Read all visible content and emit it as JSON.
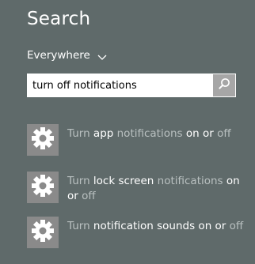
{
  "header": {
    "title": "Search"
  },
  "scope": {
    "label": "Everywhere"
  },
  "search": {
    "value": "turn off notifications",
    "button_icon": "search-icon"
  },
  "results": [
    {
      "icon": "gear-icon",
      "segments": [
        {
          "text": "Turn ",
          "dim": true
        },
        {
          "text": "app ",
          "dim": false
        },
        {
          "text": "notifications ",
          "dim": true
        },
        {
          "text": "on or ",
          "dim": false
        },
        {
          "text": "off",
          "dim": true
        }
      ]
    },
    {
      "icon": "gear-icon",
      "segments": [
        {
          "text": "Turn ",
          "dim": true
        },
        {
          "text": "lock screen ",
          "dim": false
        },
        {
          "text": "notifications ",
          "dim": true
        },
        {
          "text": "on or ",
          "dim": false
        },
        {
          "text": "off",
          "dim": true
        }
      ]
    },
    {
      "icon": "gear-icon",
      "segments": [
        {
          "text": "Turn ",
          "dim": true
        },
        {
          "text": "notification sounds on or ",
          "dim": false
        },
        {
          "text": "off",
          "dim": true
        }
      ]
    }
  ],
  "colors": {
    "background": "#5f6a6a",
    "tile": "#8a8a8a",
    "dim_text": "#b9c0c0",
    "search_button": "#a6a6a6"
  }
}
